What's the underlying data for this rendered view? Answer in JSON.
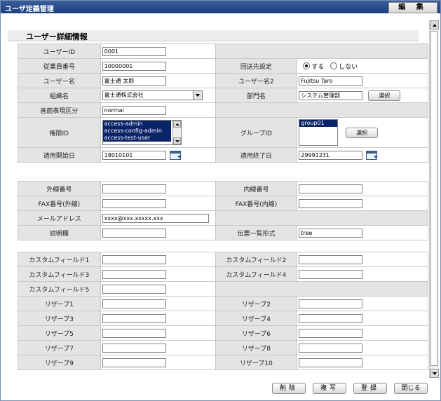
{
  "window": {
    "title": "ユーザ定義管理",
    "edit_label": "編 集"
  },
  "section": {
    "title": "ユーザー詳細情報"
  },
  "fields": {
    "user_id": {
      "label": "ユーザーID",
      "value": "0001"
    },
    "employee_no": {
      "label": "従業員番号",
      "value": "10000001"
    },
    "reply_setting": {
      "label": "回送先設定",
      "option_yes": "する",
      "option_no": "しない",
      "selected": "yes"
    },
    "user_name": {
      "label": "ユーザー名",
      "value": "富士通 太郎"
    },
    "user_name2": {
      "label": "ユーザー名2",
      "value": "Fujitsu Taro"
    },
    "organization": {
      "label": "組織名",
      "value": "富士通株式会社"
    },
    "department": {
      "label": "部門名",
      "value": "システム管理部",
      "select_label": "選択"
    },
    "screen_display": {
      "label": "画面表現区分",
      "value": "normal"
    },
    "authority": {
      "label": "権限ID",
      "options": [
        "access-admin",
        "access-config-admin",
        "access-test-user"
      ]
    },
    "group": {
      "label": "グループID",
      "options": [
        "group01"
      ],
      "select_label": "選択"
    },
    "start_date": {
      "label": "適用開始日",
      "value": "18010101"
    },
    "end_date": {
      "label": "適用終了日",
      "value": "29991231"
    }
  },
  "contact": {
    "external_no": {
      "label": "外線番号",
      "value": ""
    },
    "internal_no": {
      "label": "内線番号",
      "value": ""
    },
    "fax_external": {
      "label": "FAX番号(外線)",
      "value": ""
    },
    "fax_internal": {
      "label": "FAX番号(内線)",
      "value": ""
    },
    "email": {
      "label": "メールアドレス",
      "value": "xxxx@xxx.xxxxx.xxx"
    },
    "description": {
      "label": "説明欄",
      "value": ""
    },
    "slip_list_format": {
      "label": "伝票一覧形式",
      "value": "tree"
    }
  },
  "custom": {
    "cf1": {
      "label": "カスタムフィールド1",
      "value": ""
    },
    "cf2": {
      "label": "カスタムフィールド2",
      "value": ""
    },
    "cf3": {
      "label": "カスタムフィールド3",
      "value": ""
    },
    "cf4": {
      "label": "カスタムフィールド4",
      "value": ""
    },
    "cf5": {
      "label": "カスタムフィールド5",
      "value": ""
    },
    "r1": {
      "label": "リザーブ1",
      "value": ""
    },
    "r2": {
      "label": "リザーブ2",
      "value": ""
    },
    "r3": {
      "label": "リザーブ3",
      "value": ""
    },
    "r4": {
      "label": "リザーブ4",
      "value": ""
    },
    "r5": {
      "label": "リザーブ5",
      "value": ""
    },
    "r6": {
      "label": "リザーブ6",
      "value": ""
    },
    "r7": {
      "label": "リザーブ7",
      "value": ""
    },
    "r8": {
      "label": "リザーブ8",
      "value": ""
    },
    "r9": {
      "label": "リザーブ9",
      "value": ""
    },
    "r10": {
      "label": "リザーブ10",
      "value": ""
    }
  },
  "footer": {
    "delete": "削除",
    "copy": "複写",
    "register": "登録",
    "close": "閉じる"
  },
  "icons": {
    "calendar": "calendar-icon",
    "dropdown": "chevron-down-icon"
  },
  "colors": {
    "title_bar": "#1c3f7d",
    "selected_option": "#0a246a",
    "label_cell": "#e4e4e4"
  }
}
